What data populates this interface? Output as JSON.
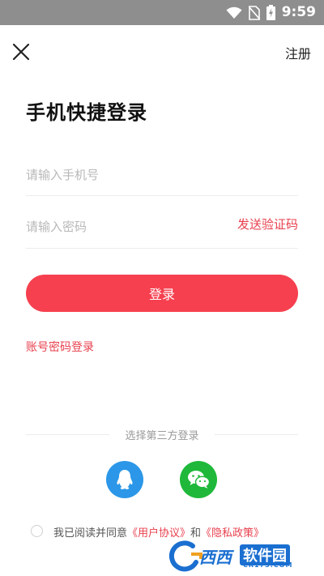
{
  "status_bar": {
    "time": "9:59"
  },
  "header": {
    "close_icon": "close-icon",
    "register_label": "注册"
  },
  "page": {
    "title": "手机快捷登录"
  },
  "form": {
    "phone_placeholder": "请输入手机号",
    "code_placeholder": "请输入密码",
    "send_code_label": "发送验证码",
    "login_label": "登录",
    "password_login_label": "账号密码登录"
  },
  "third_party": {
    "label": "选择第三方登录",
    "options": [
      {
        "icon": "qq-icon",
        "color": "#2c97e8"
      },
      {
        "icon": "wechat-icon",
        "color": "#1fb83a"
      }
    ]
  },
  "agreement": {
    "prefix": "我已阅读并同意",
    "user_agreement": "《用户协议》",
    "and": "和",
    "privacy_policy": "《隐私政策》"
  },
  "watermark": {
    "brand": "西西",
    "name": "软件园",
    "url": "CR173.COM"
  },
  "colors": {
    "accent": "#f6404f",
    "link_red": "#e8404e",
    "status_bar": "#8e8e8e"
  }
}
